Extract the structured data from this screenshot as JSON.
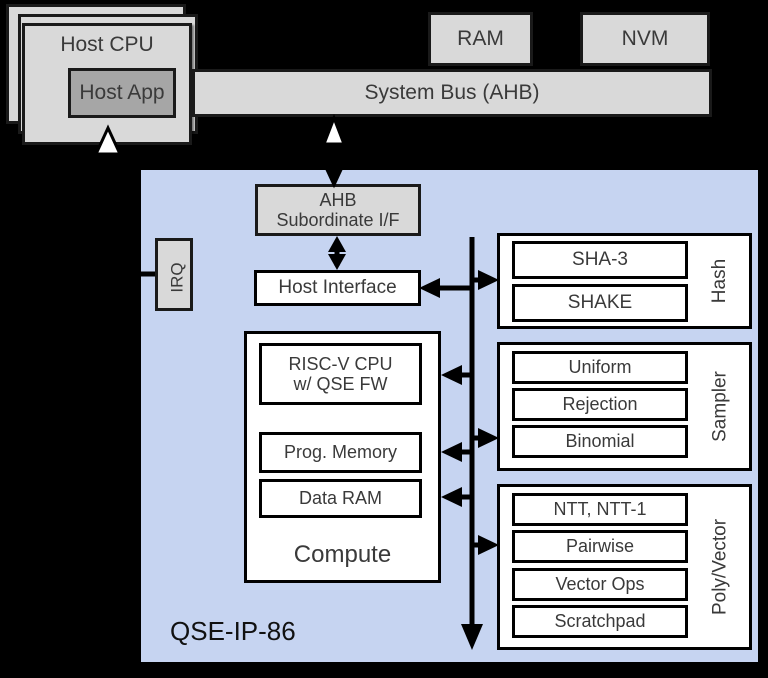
{
  "diagram": {
    "title": "QSE-IP-86",
    "ip_label": "QSE-IP-86",
    "colors": {
      "ip_panel": "#c6d4f1",
      "grey_block": "#d9d9d9",
      "dark_grey_block": "#a6a6a6",
      "white_block": "#ffffff",
      "outline": "#000000",
      "background": "#000000"
    }
  },
  "host": {
    "cpu_label": "Host CPU",
    "app_label": "Host App",
    "stack_count": 3
  },
  "memory": {
    "ram_label": "RAM",
    "nvm_label": "NVM"
  },
  "bus": {
    "label": "System Bus (AHB)"
  },
  "ip": {
    "ahb_subordinate": {
      "line1": "AHB",
      "line2": "Subordinate I/F"
    },
    "host_interface_label": "Host Interface",
    "irq_label": "IRQ",
    "compute": {
      "group_label": "Compute",
      "items": [
        {
          "line1": "RISC-V CPU",
          "line2": "w/ QSE FW"
        },
        {
          "line1": "Prog. Memory",
          "line2": ""
        },
        {
          "line1": "Data RAM",
          "line2": ""
        }
      ]
    },
    "hash": {
      "group_label": "Hash",
      "items": [
        "SHA-3",
        "SHAKE"
      ]
    },
    "sampler": {
      "group_label": "Sampler",
      "items": [
        "Uniform",
        "Rejection",
        "Binomial"
      ]
    },
    "polyvector": {
      "group_label": "Poly/Vector",
      "items": [
        "NTT, NTT-1",
        "Pairwise",
        "Vector Ops",
        "Scratchpad"
      ]
    }
  }
}
